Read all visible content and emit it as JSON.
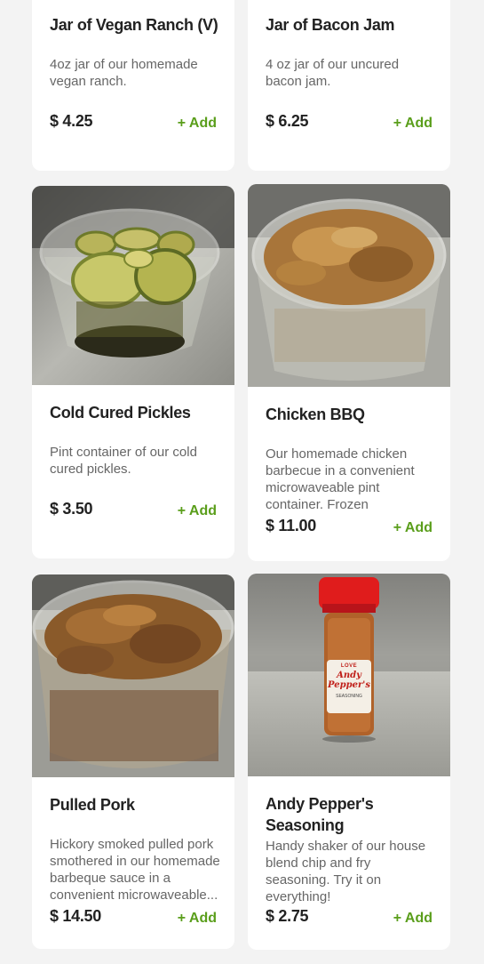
{
  "products": [
    {
      "title": "Jar of Vegan Ranch (V)",
      "description": "4oz jar of our homemade vegan ranch.",
      "price": "$ 4.25",
      "add_label": "+ Add"
    },
    {
      "title": "Jar of Bacon Jam",
      "description": "4 oz jar of our uncured bacon jam.",
      "price": "$ 6.25",
      "add_label": "+ Add"
    },
    {
      "title": "Cold Cured Pickles",
      "description": "Pint container of our cold cured pickles.",
      "price": "$ 3.50",
      "add_label": "+ Add"
    },
    {
      "title": "Chicken BBQ",
      "description": "Our homemade chicken barbecue in a convenient microwaveable pint container. Frozen",
      "price": "$ 11.00",
      "add_label": "+ Add"
    },
    {
      "title": "Pulled Pork",
      "description": "Hickory smoked pulled pork smothered in our homemade barbeque sauce in a convenient microwaveable...",
      "price": "$ 14.50",
      "add_label": "+ Add"
    },
    {
      "title": "Andy Pepper's Seasoning",
      "description": "Handy shaker of our house blend chip and fry seasoning. Try it on everything!",
      "price": "$ 2.75",
      "add_label": "+ Add"
    }
  ],
  "seasoning_label": {
    "top": "LOVE",
    "brand": "Andy Pepper's",
    "bottom": "SEASONING"
  },
  "colors": {
    "accent": "#5a9e1b",
    "background": "#f3f3f3",
    "card": "#ffffff"
  }
}
